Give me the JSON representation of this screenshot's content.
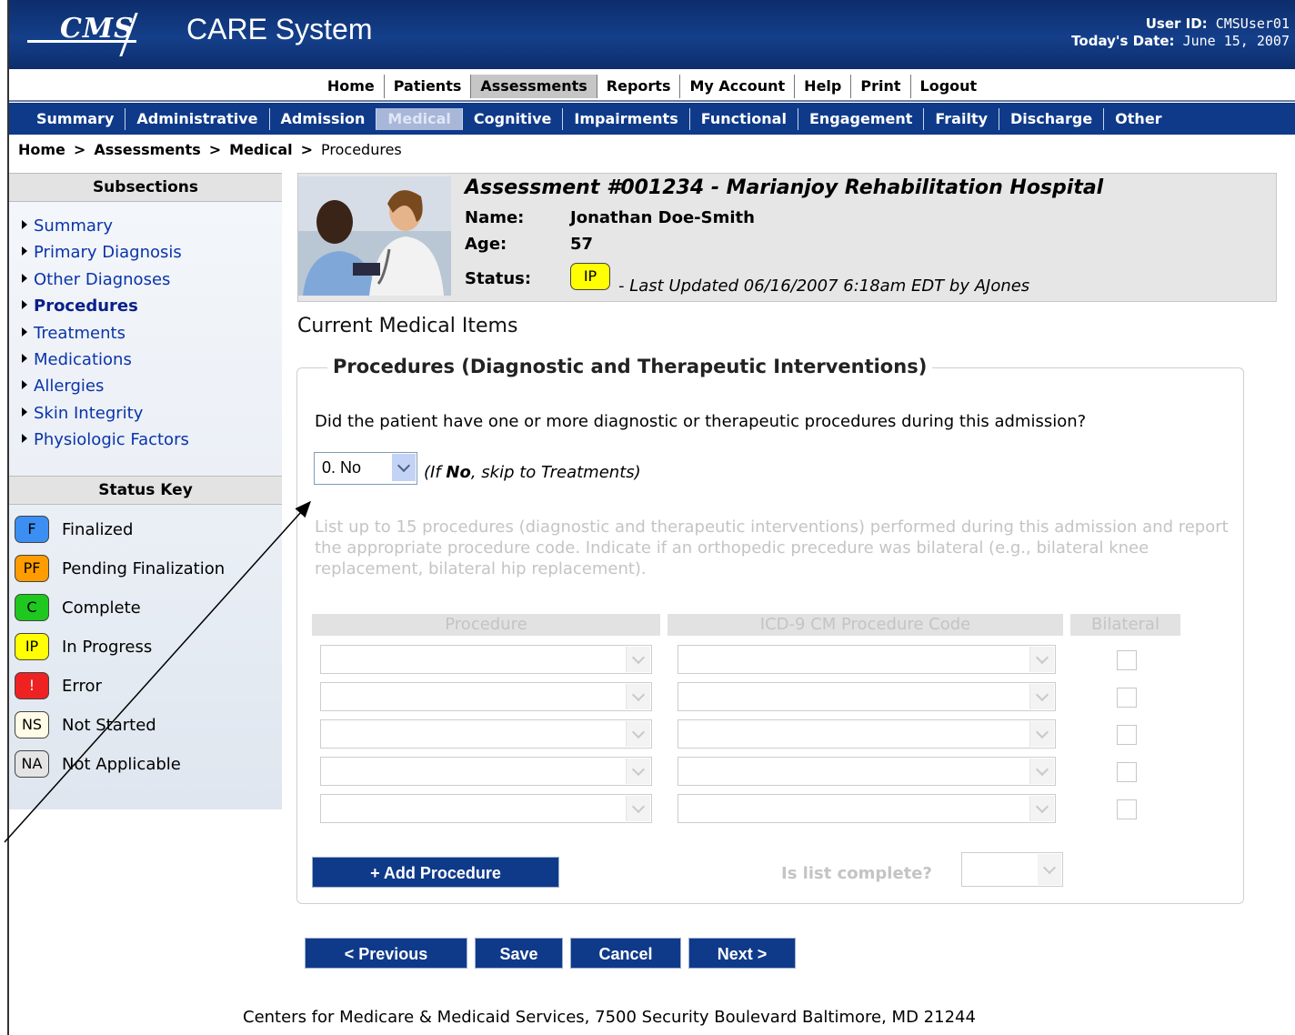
{
  "header": {
    "logo_text": "CMS",
    "app_title": "CARE System",
    "user_id_label": "User ID:",
    "user_id": "CMSUser01",
    "date_label": "Today's Date:",
    "date": "June 15, 2007",
    "bg_color": "#143f8a"
  },
  "top_nav": [
    "Home",
    "Patients",
    "Assessments",
    "Reports",
    "My Account",
    "Help",
    "Print",
    "Logout"
  ],
  "top_nav_active": "Assessments",
  "tabs": [
    "Summary",
    "Administrative",
    "Admission",
    "Medical",
    "Cognitive",
    "Impairments",
    "Functional",
    "Engagement",
    "Frailty",
    "Discharge",
    "Other"
  ],
  "tab_active": "Medical",
  "breadcrumb": {
    "items": [
      "Home",
      "Assessments",
      "Medical"
    ],
    "current": "Procedures",
    "separator": ">"
  },
  "sidebar": {
    "title": "Subsections",
    "items": [
      "Summary",
      "Primary Diagnosis",
      "Other Diagnoses",
      "Procedures",
      "Treatments",
      "Medications",
      "Allergies",
      "Skin Integrity",
      "Physiologic Factors"
    ],
    "current": "Procedures",
    "status_key_title": "Status Key",
    "status_key": [
      {
        "code": "F",
        "label": "Finalized",
        "color": "#3b8ff2"
      },
      {
        "code": "PF",
        "label": "Pending Finalization",
        "color": "#ff9d00"
      },
      {
        "code": "C",
        "label": "Complete",
        "color": "#1ec81e"
      },
      {
        "code": "IP",
        "label": "In Progress",
        "color": "#ffff00"
      },
      {
        "code": "!",
        "label": "Error",
        "color": "#ee2222"
      },
      {
        "code": "NS",
        "label": "Not Started",
        "color": "#fffbe6"
      },
      {
        "code": "NA",
        "label": "Not Applicable",
        "color": "#e4e4e4"
      }
    ]
  },
  "assessment": {
    "title": "Assessment #001234 - Marianjoy Rehabilitation Hospital",
    "name_label": "Name:",
    "name": "Jonathan Doe-Smith",
    "age_label": "Age:",
    "age": "57",
    "status_label": "Status:",
    "status_code": "IP",
    "last_updated": "- Last Updated 06/16/2007 6:18am EDT by AJones"
  },
  "main": {
    "section_title": "Current Medical Items",
    "fieldset_title": "Procedures (Diagnostic and Therapeutic Interventions)",
    "question": "Did the patient have one or more diagnostic or therapeutic procedures during this admission?",
    "answer_value": "0. No",
    "skip_pre": "(If ",
    "skip_bold": "No",
    "skip_post": ", skip to Treatments)",
    "description": "List up to 15 procedures (diagnostic and therapeutic interventions) performed during this admission and report the appropriate procedure code. Indicate if an orthopedic precedure was bilateral (e.g., bilateral knee replacement, bilateral hip replacement).",
    "columns": [
      "Procedure",
      "ICD-9 CM Procedure Code",
      "Bilateral"
    ],
    "rows": [
      {
        "procedure": "",
        "code": "",
        "bilateral": false
      },
      {
        "procedure": "",
        "code": "",
        "bilateral": false
      },
      {
        "procedure": "",
        "code": "",
        "bilateral": false
      },
      {
        "procedure": "",
        "code": "",
        "bilateral": false
      },
      {
        "procedure": "",
        "code": "",
        "bilateral": false
      }
    ],
    "add_button": "+ Add Procedure",
    "complete_label": "Is list complete?",
    "complete_value": ""
  },
  "actions": {
    "previous": "< Previous",
    "save": "Save",
    "cancel": "Cancel",
    "next": "Next >"
  },
  "footer": "Centers for Medicare & Medicaid Services, 7500 Security Boulevard Baltimore, MD 21244"
}
